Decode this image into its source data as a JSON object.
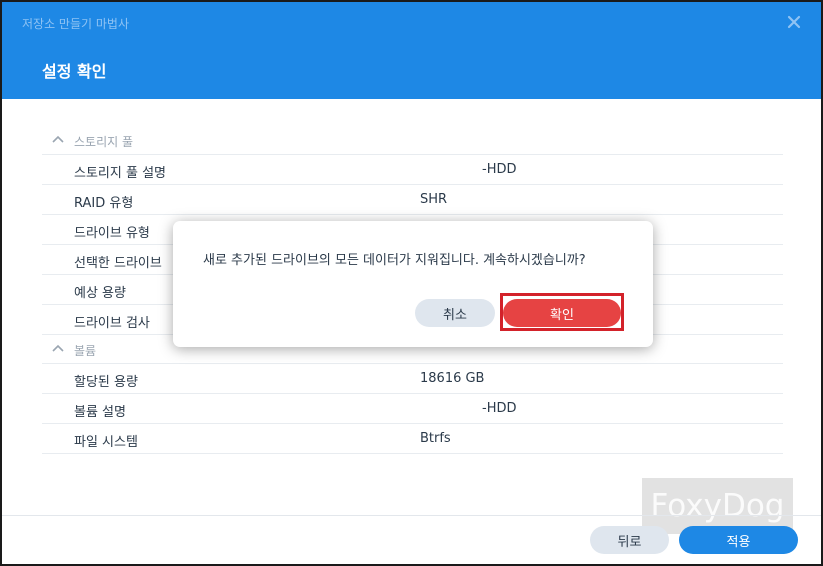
{
  "window": {
    "title": "저장소 만들기 마법사",
    "step_title": "설정 확인"
  },
  "storage_pool": {
    "section_label": "스토리지 풀",
    "rows": [
      {
        "key": "스토리지 풀 설명",
        "value": "-HDD"
      },
      {
        "key": "RAID 유형",
        "value": "SHR"
      },
      {
        "key": "드라이브 유형",
        "value": ""
      },
      {
        "key": "선택한 드라이브",
        "value": ""
      },
      {
        "key": "예상 용량",
        "value": ""
      },
      {
        "key": "드라이브 검사",
        "value": ""
      }
    ]
  },
  "volume": {
    "section_label": "볼륨",
    "rows": [
      {
        "key": "할당된 용량",
        "value": "18616 GB"
      },
      {
        "key": "볼륨 설명",
        "value": "-HDD"
      },
      {
        "key": "파일 시스템",
        "value": "Btrfs"
      }
    ]
  },
  "footer": {
    "back_label": "뒤로",
    "apply_label": "적용"
  },
  "dialog": {
    "message": "새로 추가된 드라이브의 모든 데이터가 지워집니다. 계속하시겠습니까?",
    "cancel_label": "취소",
    "confirm_label": "확인"
  },
  "watermark": "FoxyDog",
  "colors": {
    "header": "#1e88e5",
    "primary_button": "#1e88e5",
    "danger_button": "#e64343",
    "highlight_box": "#d3222a"
  },
  "icons": [
    "close-icon",
    "chevron-up-icon"
  ]
}
